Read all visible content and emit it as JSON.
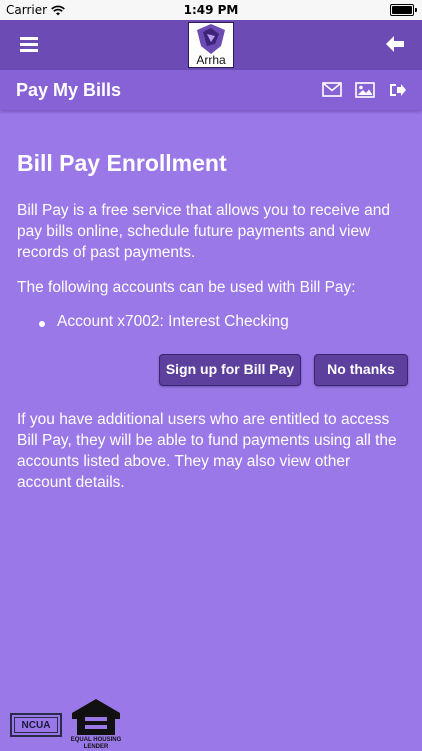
{
  "status_bar": {
    "carrier": "Carrier",
    "time": "1:49 PM",
    "battery_level": 1.0
  },
  "top_nav": {
    "logo_text": "Arrha",
    "menu_icon": "hamburger-menu-icon",
    "back_icon": "arrow-left-icon"
  },
  "sub_header": {
    "title": "Pay My Bills",
    "icons": [
      "envelope-icon",
      "image-icon",
      "logout-icon"
    ]
  },
  "content": {
    "heading": "Bill Pay Enrollment",
    "intro": "Bill Pay is a free service that allows you to receive and pay bills online, schedule future payments and view records of past payments.",
    "accounts_label": "The following accounts can be used with Bill Pay:",
    "accounts": [
      "Account x7002: Interest Checking"
    ],
    "signup_button": "Sign up for Bill Pay",
    "no_thanks_button": "No thanks",
    "additional_users": "If you have additional users who are entitled to access Bill Pay, they will be able to fund payments using all the accounts listed above. They may also view other account details."
  },
  "footer": {
    "ncua_text": "NCUA",
    "equal_housing_text": "EQUAL HOUSING LENDER"
  },
  "colors": {
    "background": "#9b78e8",
    "nav": "#6c4bb5",
    "sub_header": "#8762d6",
    "button": "#5d3f9e"
  }
}
